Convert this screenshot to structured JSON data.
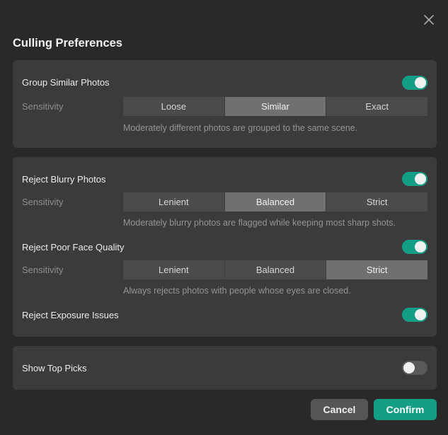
{
  "dialog": {
    "title": "Culling Preferences",
    "close_icon": "close-icon"
  },
  "group_similar": {
    "label": "Group Similar Photos",
    "enabled": true,
    "sensitivity_label": "Sensitivity",
    "options": [
      "Loose",
      "Similar",
      "Exact"
    ],
    "selected": "Similar",
    "description": "Moderately different photos are grouped to the same scene."
  },
  "reject_blurry": {
    "label": "Reject Blurry Photos",
    "enabled": true,
    "sensitivity_label": "Sensitivity",
    "options": [
      "Lenient",
      "Balanced",
      "Strict"
    ],
    "selected": "Balanced",
    "description": "Moderately blurry photos are flagged while keeping most sharp shots."
  },
  "reject_face": {
    "label": "Reject Poor Face Quality",
    "enabled": true,
    "sensitivity_label": "Sensitivity",
    "options": [
      "Lenient",
      "Balanced",
      "Strict"
    ],
    "selected": "Strict",
    "description": "Always rejects photos with people whose eyes are closed."
  },
  "reject_exposure": {
    "label": "Reject Exposure Issues",
    "enabled": true
  },
  "top_picks": {
    "label": "Show Top Picks",
    "enabled": false
  },
  "footer": {
    "cancel_label": "Cancel",
    "confirm_label": "Confirm"
  },
  "colors": {
    "accent": "#139e85",
    "background": "#292929",
    "card": "#3b3b3b"
  }
}
